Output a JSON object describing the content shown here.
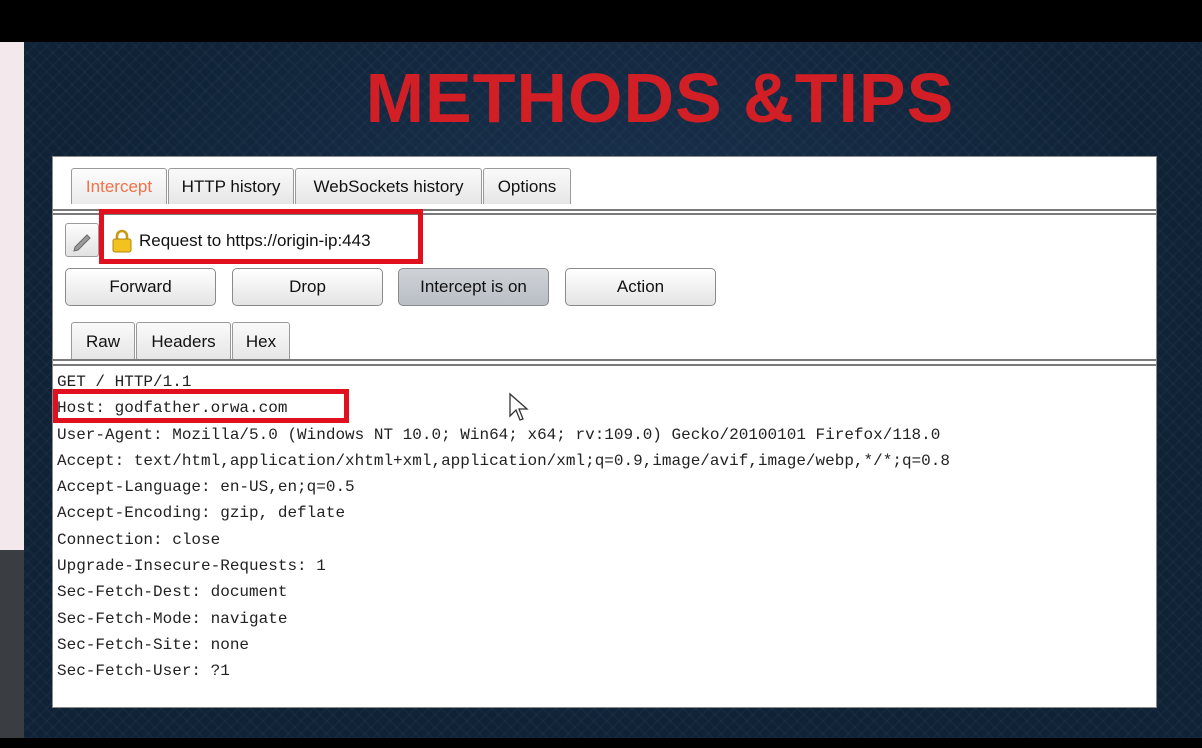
{
  "slide": {
    "title": "METHODS &TIPS",
    "title_color": "#d21e25",
    "highlight_color": "#e0101f"
  },
  "tabs": [
    {
      "label": "Intercept",
      "active": true
    },
    {
      "label": "HTTP history",
      "active": false
    },
    {
      "label": "WebSockets history",
      "active": false
    },
    {
      "label": "Options",
      "active": false
    }
  ],
  "request": {
    "label": "Request to https://origin-ip:443",
    "icons": {
      "edit": "pencil-icon",
      "lock": "lock-icon"
    }
  },
  "buttons": {
    "forward": "Forward",
    "drop": "Drop",
    "intercept": "Intercept is on",
    "action": "Action"
  },
  "message_tabs": [
    {
      "label": "Raw",
      "active": true
    },
    {
      "label": "Headers",
      "active": false
    },
    {
      "label": "Hex",
      "active": false
    }
  ],
  "raw_lines": [
    "GET / HTTP/1.1",
    "Host: godfather.orwa.com",
    "User-Agent: Mozilla/5.0 (Windows NT 10.0; Win64; x64; rv:109.0) Gecko/20100101 Firefox/118.0",
    "Accept: text/html,application/xhtml+xml,application/xml;q=0.9,image/avif,image/webp,*/*;q=0.8",
    "Accept-Language: en-US,en;q=0.5",
    "Accept-Encoding: gzip, deflate",
    "Connection: close",
    "Upgrade-Insecure-Requests: 1",
    "Sec-Fetch-Dest: document",
    "Sec-Fetch-Mode: navigate",
    "Sec-Fetch-Site: none",
    "Sec-Fetch-User: ?1"
  ]
}
